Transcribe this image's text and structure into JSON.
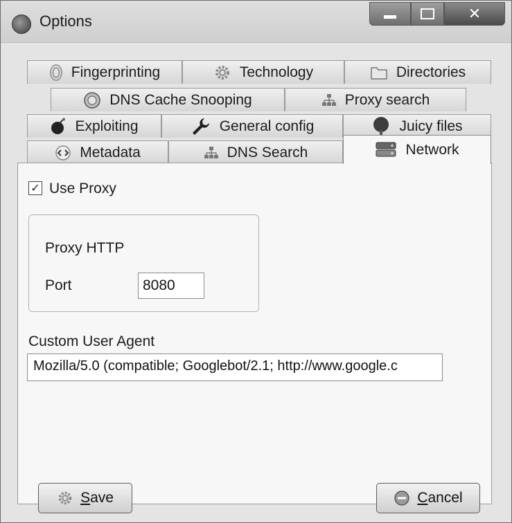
{
  "window": {
    "title": "Options"
  },
  "tabs": {
    "fingerprinting": "Fingerprinting",
    "technology": "Technology",
    "directories": "Directories",
    "dns_cache": "DNS Cache Snooping",
    "proxy_search": "Proxy search",
    "exploiting": "Exploiting",
    "general": "General config",
    "juicy": "Juicy files",
    "metadata": "Metadata",
    "dns_search": "DNS Search",
    "network": "Network"
  },
  "network": {
    "use_proxy_label": "Use Proxy",
    "use_proxy_checked": true,
    "proxy_http_label": "Proxy HTTP",
    "port_label": "Port",
    "port_value": "8080",
    "ua_label": "Custom User Agent",
    "ua_value": "Mozilla/5.0 (compatible; Googlebot/2.1;  http://www.google.c"
  },
  "buttons": {
    "save_prefix": "S",
    "save_rest": "ave",
    "cancel_prefix": "C",
    "cancel_rest": "ancel"
  },
  "icons": {
    "fingerprint": "fingerprint-icon",
    "gear": "gear-icon",
    "folder": "folder-icon",
    "globe": "globe-icon",
    "network": "network-tree-icon",
    "bomb": "bomb-icon",
    "wrench": "wrench-icon",
    "tree": "tree-icon",
    "code": "code-icon",
    "server": "server-icon",
    "cancel": "cancel-icon"
  }
}
